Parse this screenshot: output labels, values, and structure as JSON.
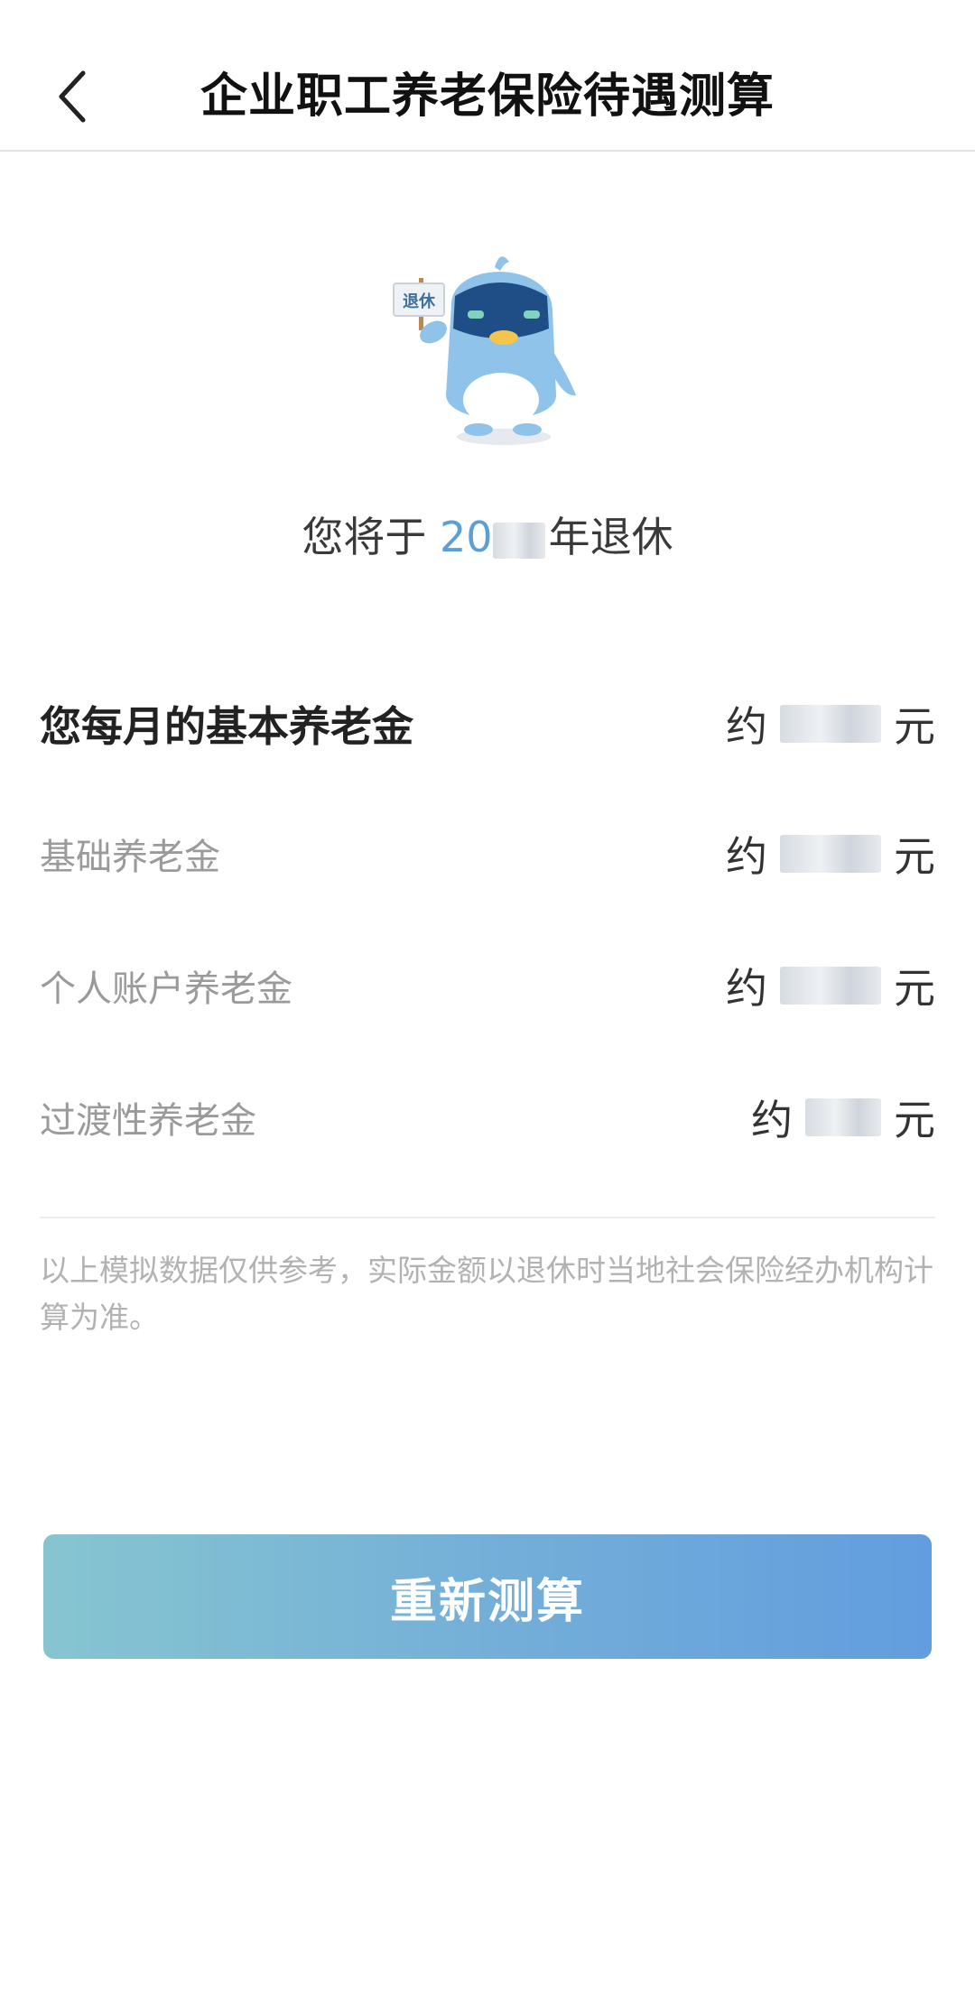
{
  "header": {
    "title": "企业职工养老保险待遇测算"
  },
  "mascot": {
    "sign_text": "退休"
  },
  "retirement": {
    "prefix": "您将于",
    "year_visible": "20",
    "suffix": "年退休"
  },
  "pension": {
    "about_label": "约",
    "unit": "元",
    "rows": [
      {
        "label": "您每月的基本养老金"
      },
      {
        "label": "基础养老金"
      },
      {
        "label": "个人账户养老金"
      },
      {
        "label": "过渡性养老金"
      }
    ]
  },
  "disclaimer": "以上模拟数据仅供参考，实际金额以退休时当地社会保险经办机构计算为准。",
  "actions": {
    "recalculate_label": "重新测算"
  },
  "colors": {
    "accent_year": "#5aa0d6",
    "button_gradient_start": "#86c5d0",
    "button_gradient_end": "#629ddf"
  }
}
